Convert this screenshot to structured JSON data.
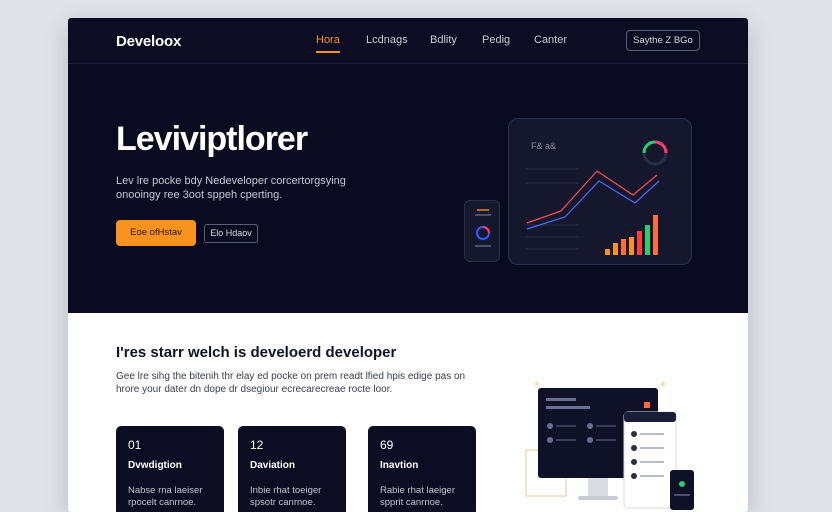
{
  "nav": {
    "brand": "Develoox",
    "links": [
      "Hora",
      "Lcdnags",
      "Bdlity",
      "Pedig",
      "Canter"
    ],
    "cta": "Saythe Z BGo"
  },
  "hero": {
    "title": "Leviviptlorer",
    "subtitle": "Lev lre pocke bdy Nedeveloper corcertorgsying onooingy ree 3oot sppeh cperting.",
    "primary_button": "Eoe ofHstav",
    "secondary_button": "Elo Hdaov",
    "dashboard_label": "F& a&"
  },
  "section": {
    "title": "I'res starr welch is develoerd developer",
    "desc": "Gee lre sihg the bitenih thr elay ed pocke on prem readt lfied hpis edige pas on hrore your dater dn dope dr dsegiour ecrecarecreae rocte loor.",
    "cards": [
      {
        "num": "01",
        "title": "Dvwdigtion",
        "body": "Nabse rna laeiser rpocelt canrnoe."
      },
      {
        "num": "12",
        "title": "Daviation",
        "body": "Inbie rhat toeiger spsotr canrnoe."
      },
      {
        "num": "69",
        "title": "Inavtion",
        "body": "Rabie rhat laeiger spprit canrnoe."
      }
    ]
  },
  "colors": {
    "accent": "#f7931e",
    "nav_bg": "#0c0d22",
    "hero_bg": "#0a0b20",
    "card_bg": "#0c0d22"
  }
}
